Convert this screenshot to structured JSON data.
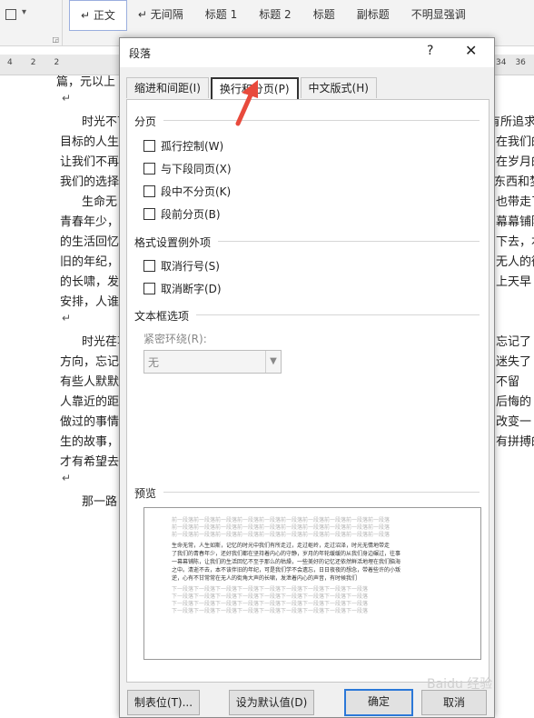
{
  "styles_gallery": {
    "items": [
      "正文",
      "无间隔",
      "标题 1",
      "标题 2",
      "标题",
      "副标题",
      "不明显强调"
    ]
  },
  "ruler": {
    "left_ticks": [
      "4",
      "2",
      "2"
    ],
    "right_ticks": [
      "34",
      "36"
    ]
  },
  "document": {
    "lines": [
      "篇，元以上",
      "时光不可",
      "目标的人生",
      "让我们不再",
      "我们的选择",
      "生命无",
      "青春年少，",
      "的生活回忆",
      "旧的年纪，",
      "的长啸，发",
      "安排，人谁",
      "时光荏苒",
      "方向，忘记",
      "有些人默默",
      "人靠近的距",
      "做过的事情",
      "生的故事，",
      "才有希望去",
      "那一路"
    ],
    "right_fragments": [
      "有所追求",
      "在我们的",
      "在岁月的",
      "东西和梦想",
      "也带走了",
      "幕幕铺陈",
      "下去，本",
      "无人的街",
      "上天早",
      "忘记了",
      "迷失了",
      "不留",
      "后悔的",
      "改变一",
      "有拼搏的"
    ]
  },
  "dialog": {
    "title": "段落",
    "help": "?",
    "close": "✕",
    "tabs": [
      "缩进和间距(I)",
      "换行和分页(P)",
      "中文版式(H)"
    ],
    "active_tab": "换行和分页(P)",
    "pagination": {
      "heading": "分页",
      "options": [
        "孤行控制(W)",
        "与下段同页(X)",
        "段中不分页(K)",
        "段前分页(B)"
      ]
    },
    "formatting_exceptions": {
      "heading": "格式设置例外项",
      "options": [
        "取消行号(S)",
        "取消断字(D)"
      ]
    },
    "textbox_options": {
      "heading": "文本框选项",
      "tight_wrap_label": "紧密环绕(R):",
      "tight_wrap_value": "无"
    },
    "preview": {
      "heading": "预览",
      "prev_paragraph": "前一段落前一段落前一段落前一段落前一段落前一段落前一段落前一段落前一段落前一段落",
      "sample_text": [
        "生命无常，人生如斯，记忆的时光中我们有所走过，走过岖岭，走过沼泽，时光无情地带走",
        "了我们的青春年少，还好我们都在坚持着内心的守静，岁月的年轮缓缓的从我们身边碾过，往事",
        "一幕幕铺陈，让我们的生活回忆不至于那么的枯燥，一些美好的记忆还依然鲜活地埋在我们脑海",
        "之中。清逝不去，本不该伴旧的年纪，可是我们学不会遗忘，日日夜夜的想念，带着些许的小叛",
        "逆，心有不甘常常在无人的街角大声的长啸，发泄着内心的声音，有时候我们"
      ],
      "next_paragraph": "下一段落下一段落下一段落下一段落下一段落下一段落下一段落下一段落下一段落"
    },
    "buttons": {
      "tabs": "制表位(T)...",
      "set_default": "设为默认值(D)",
      "ok": "确定",
      "cancel": "取消"
    }
  },
  "annotation_color": "#e84a3c",
  "watermark": "Baidu 经验"
}
